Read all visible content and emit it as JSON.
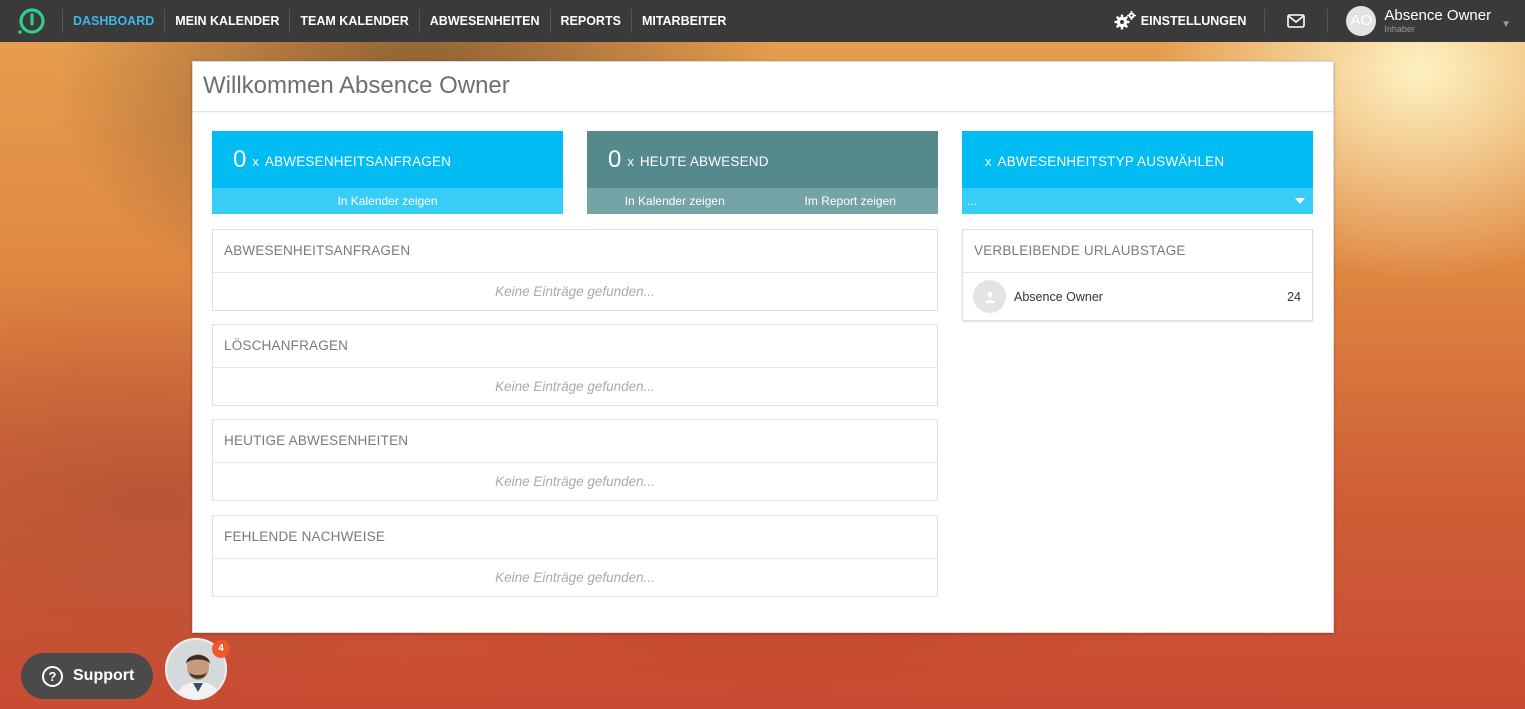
{
  "nav": {
    "items": [
      {
        "label": "DASHBOARD",
        "active": true
      },
      {
        "label": "MEIN KALENDER",
        "active": false
      },
      {
        "label": "TEAM KALENDER",
        "active": false
      },
      {
        "label": "ABWESENHEITEN",
        "active": false
      },
      {
        "label": "REPORTS",
        "active": false
      },
      {
        "label": "MITARBEITER",
        "active": false
      }
    ],
    "settings_label": "EINSTELLUNGEN",
    "user": {
      "initials": "AO",
      "name": "Absence Owner",
      "role": "Inhaber"
    }
  },
  "card": {
    "title": "Willkommen Absence Owner",
    "tiles": [
      {
        "count": "0",
        "x": "x",
        "label": "ABWESENHEITSANFRAGEN",
        "links": [
          "In Kalender zeigen"
        ]
      },
      {
        "count": "0",
        "x": "x",
        "label": "HEUTE ABWESEND",
        "links": [
          "In Kalender zeigen",
          "Im Report zeigen"
        ]
      },
      {
        "x": "x",
        "label": "ABWESENHEITSTYP AUSWÄHLEN",
        "select_value": "..."
      }
    ],
    "panels": [
      {
        "title": "ABWESENHEITSANFRAGEN",
        "empty": "Keine Einträge gefunden..."
      },
      {
        "title": "LÖSCHANFRAGEN",
        "empty": "Keine Einträge gefunden..."
      },
      {
        "title": "HEUTIGE ABWESENHEITEN",
        "empty": "Keine Einträge gefunden..."
      },
      {
        "title": "FEHLENDE NACHWEISE",
        "empty": "Keine Einträge gefunden..."
      }
    ],
    "remaining": {
      "title": "VERBLEIBENDE URLAUBSTAGE",
      "rows": [
        {
          "name": "Absence Owner",
          "days": "24"
        }
      ]
    }
  },
  "support": {
    "label": "Support",
    "badge": "4"
  },
  "colors": {
    "accent": "#3fb7e6",
    "tile_blue": "#00bcf2",
    "tile_teal": "#548a8c",
    "topbar": "#3a3a3a"
  }
}
